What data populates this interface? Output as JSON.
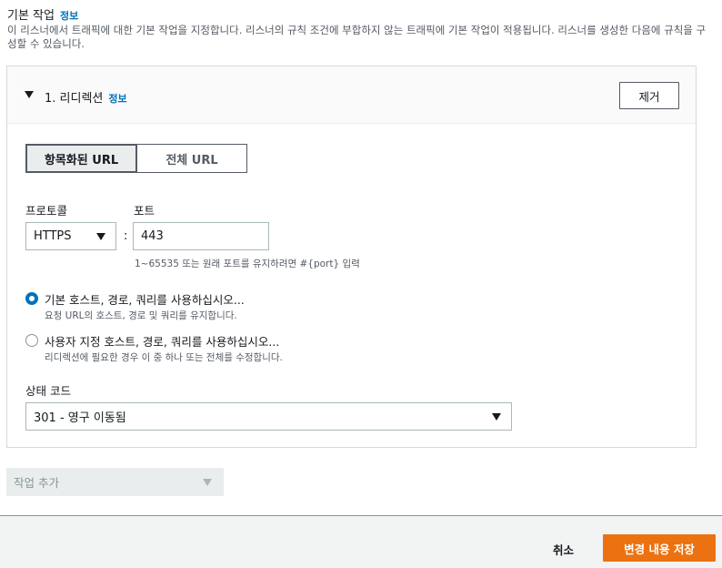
{
  "header": {
    "title": "기본 작업",
    "info": "정보",
    "description": "이 리스너에서 트래픽에 대한 기본 작업을 지정합니다. 리스너의 규칙 조건에 부합하지 않는 트래픽에 기본 작업이 적용됩니다. 리스너를 생성한 다음에 규칙을 구성할 수 있습니다."
  },
  "action": {
    "title": "1. 리디렉션",
    "info": "정보",
    "remove_label": "제거",
    "url_mode": {
      "options": [
        "항목화된 URL",
        "전체 URL"
      ],
      "selected": "항목화된 URL"
    },
    "protocol": {
      "label": "프로토콜",
      "value": "HTTPS"
    },
    "separator": ":",
    "port": {
      "label": "포트",
      "value": "443",
      "hint": "1~65535 또는 원래 포트를 유지하려면 #{port} 입력"
    },
    "radios": [
      {
        "label": "기본 호스트, 경로, 쿼리를 사용하십시오...",
        "description": "요청 URL의 호스트, 경로 및 쿼리를 유지합니다.",
        "checked": true
      },
      {
        "label": "사용자 지정 호스트, 경로, 쿼리를 사용하십시오...",
        "description": "리디렉션에 필요한 경우 이 중 하나 또는 전체를 수정합니다.",
        "checked": false
      }
    ],
    "status_code": {
      "label": "상태 코드",
      "value": "301 - 영구 이동됨"
    }
  },
  "add_action": {
    "label": "작업 추가"
  },
  "footer": {
    "cancel_label": "취소",
    "save_label": "변경 내용 저장"
  },
  "colors": {
    "link": "#0073bb",
    "primary": "#ec7211",
    "radio_checked": "#0073bb"
  }
}
